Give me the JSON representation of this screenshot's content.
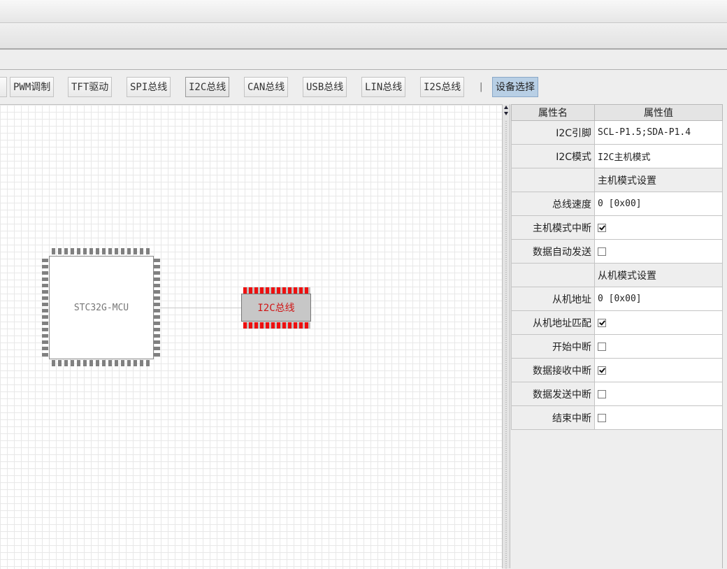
{
  "toolbar": {
    "buttons": [
      {
        "label": "PWM调制"
      },
      {
        "label": "TFT驱动"
      },
      {
        "label": "SPI总线"
      },
      {
        "label": "I2C总线"
      },
      {
        "label": "CAN总线"
      },
      {
        "label": "USB总线"
      },
      {
        "label": "LIN总线"
      },
      {
        "label": "I2S总线"
      }
    ],
    "separator": "|",
    "device_select": "设备选择"
  },
  "canvas": {
    "mcu_label": "STC32G-MCU",
    "peripheral_label": "I2C总线"
  },
  "properties": {
    "header_name": "属性名",
    "header_value": "属性值",
    "rows": [
      {
        "name": "I2C引脚",
        "value": "SCL-P1.5;SDA-P1.4"
      },
      {
        "name": "I2C模式",
        "value": "I2C主机模式"
      },
      {
        "name": "",
        "value": "主机模式设置"
      },
      {
        "name": "总线速度",
        "value": "0 [0x00]"
      },
      {
        "name": "主机模式中断",
        "checked": true
      },
      {
        "name": "数据自动发送",
        "checked": false
      },
      {
        "name": "",
        "value": "从机模式设置"
      },
      {
        "name": "从机地址",
        "value": "0 [0x00]"
      },
      {
        "name": "从机地址匹配",
        "checked": true
      },
      {
        "name": "开始中断",
        "checked": false
      },
      {
        "name": "数据接收中断",
        "checked": true
      },
      {
        "name": "数据发送中断",
        "checked": false
      },
      {
        "name": "结束中断",
        "checked": false
      }
    ]
  }
}
